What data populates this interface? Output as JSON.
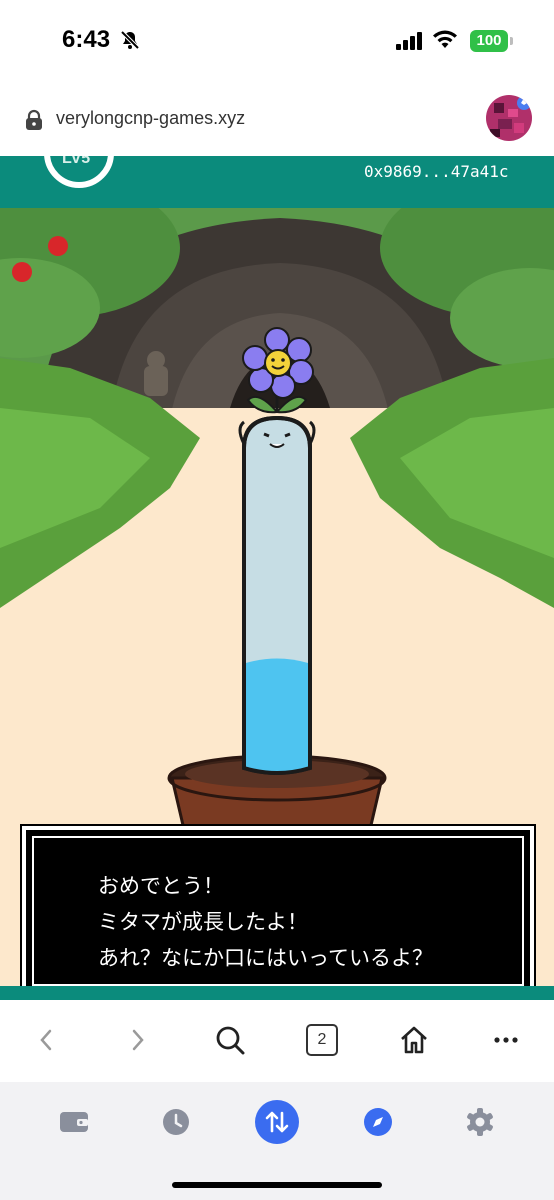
{
  "status": {
    "time": "6:43",
    "battery": "100"
  },
  "browser": {
    "url": "verylongcnp-games.xyz",
    "tab_count": "2"
  },
  "game": {
    "level_label": "LV5",
    "wallet_address": "0x9869...47a41c",
    "dialog": [
      "おめでとう！",
      "ミタマが成長したよ！",
      "あれ？なにか口にはいっているよ？"
    ],
    "water_level": 0.28
  },
  "colors": {
    "teal": "#0b8b7c",
    "accent_blue": "#3a6cf0",
    "battery_green": "#30c048"
  },
  "icons": {
    "back": "chevron-left-icon",
    "forward": "chevron-right-icon",
    "search": "search-icon",
    "home": "home-icon",
    "more": "more-icon",
    "wallet": "wallet-icon",
    "history": "clock-icon",
    "swap": "swap-icon",
    "explore": "compass-icon",
    "settings": "gear-icon"
  }
}
